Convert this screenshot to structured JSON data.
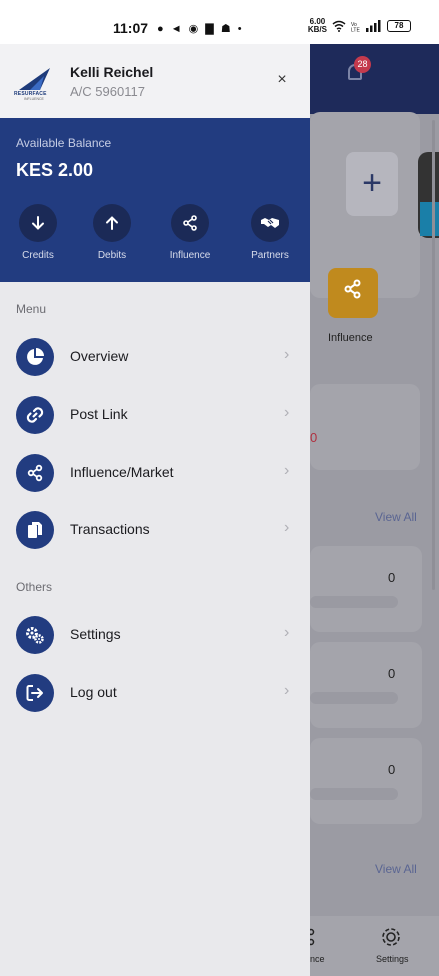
{
  "status_bar": {
    "time": "11:07",
    "notification_icons": "● ◄ ◉ ▇ ☗ •",
    "speed_value": "6.00",
    "speed_unit": "KB/S",
    "battery": "78"
  },
  "drawer": {
    "logo_text": "RESURFACE",
    "logo_sub": "INFLUENCE",
    "user_name": "Kelli Reichel",
    "account": "A/C 5960117",
    "close_icon": "×",
    "balance": {
      "label": "Available Balance",
      "amount": "KES 2.00"
    },
    "actions": [
      {
        "label": "Credits",
        "icon": "arrow-down-icon"
      },
      {
        "label": "Debits",
        "icon": "arrow-up-icon"
      },
      {
        "label": "Influence",
        "icon": "share-icon"
      },
      {
        "label": "Partners",
        "icon": "handshake-icon"
      }
    ],
    "menu_section_label": "Menu",
    "menu_items": [
      {
        "label": "Overview",
        "icon": "pie-chart-icon"
      },
      {
        "label": "Post Link",
        "icon": "link-icon"
      },
      {
        "label": "Influence/Market",
        "icon": "share-icon"
      },
      {
        "label": "Transactions",
        "icon": "copy-icon"
      }
    ],
    "others_section_label": "Others",
    "other_items": [
      {
        "label": "Settings",
        "icon": "cogs-icon"
      },
      {
        "label": "Log out",
        "icon": "logout-icon"
      }
    ]
  },
  "background_app": {
    "notification_count": "28",
    "influence_label": "Influence",
    "red_value": "0",
    "view_all_label": "View All",
    "zero_values": [
      "0",
      "0",
      "0"
    ],
    "nav_items": [
      "nce",
      "Settings"
    ]
  }
}
